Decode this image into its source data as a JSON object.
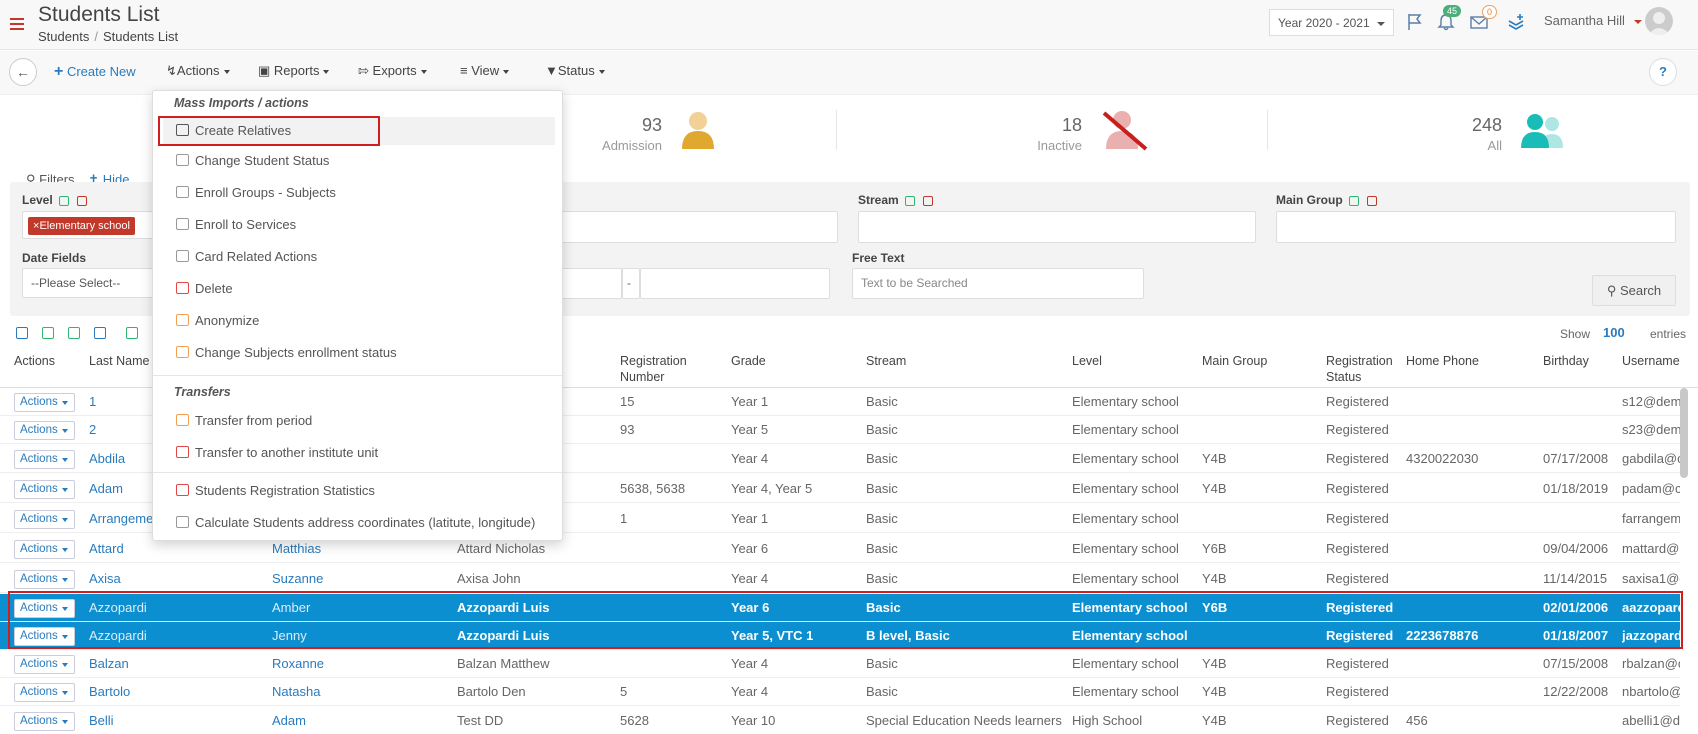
{
  "header": {
    "title": "Students List",
    "breadcrumb": [
      "Students",
      "Students List"
    ],
    "year": "Year 2020 - 2021",
    "notifications_count": "45",
    "messages_count": "0",
    "user_name": "Samantha Hill"
  },
  "toolbar": {
    "create_new": "Create New",
    "actions": "Actions",
    "reports": "Reports",
    "exports": "Exports",
    "view": "View",
    "status": "Status",
    "help": "?"
  },
  "stats": [
    {
      "value": "93",
      "label": "Admission",
      "color": "#e0a82e"
    },
    {
      "value": "18",
      "label": "Inactive",
      "color": "#e8a0a0"
    },
    {
      "value": "248",
      "label": "All",
      "color": "#1abcb8"
    }
  ],
  "filters": {
    "title": "Filters",
    "hide": "Hide",
    "level_label": "Level",
    "level_tag": "Elementary school",
    "stream_label": "Stream",
    "main_group_label": "Main Group",
    "date_fields_label": "Date Fields",
    "date_placeholder": "--Please Select--",
    "date_sep": "-",
    "free_text_label": "Free Text",
    "free_text_placeholder": "Text to be Searched",
    "search": "Search"
  },
  "table": {
    "show_label": "Show",
    "show_value": "100",
    "entries_label": "entries",
    "columns": [
      "Actions",
      "Last Name",
      "Registration Number",
      "Grade",
      "Stream",
      "Level",
      "Main Group",
      "Registration Status",
      "Home Phone",
      "Birthday",
      "Username"
    ],
    "action_label": "Actions",
    "rows": [
      {
        "last": "1",
        "first": "",
        "parent": "",
        "reg": "15",
        "grade": "Year 1",
        "stream": "Basic",
        "level": "Elementary school",
        "group": "",
        "status": "Registered",
        "phone": "",
        "birthday": "",
        "user": "s12@dem"
      },
      {
        "last": "2",
        "first": "",
        "parent": "",
        "reg": "93",
        "grade": "Year 5",
        "stream": "Basic",
        "level": "Elementary school",
        "group": "",
        "status": "Registered",
        "phone": "",
        "birthday": "",
        "user": "s23@dem"
      },
      {
        "last": "Abdila",
        "first": "",
        "parent": "",
        "reg": "",
        "grade": "Year 4",
        "stream": "Basic",
        "level": "Elementary school",
        "group": "Y4B",
        "status": "Registered",
        "phone": "4320022030",
        "birthday": "07/17/2008",
        "user": "gabdila@c"
      },
      {
        "last": "Adam",
        "first": "",
        "parent": "",
        "reg": "5638, 5638",
        "grade": "Year 4, Year 5",
        "stream": "Basic",
        "level": "Elementary school",
        "group": "Y4B",
        "status": "Registered",
        "phone": "",
        "birthday": "01/18/2019",
        "user": "padam@c"
      },
      {
        "last": "Arrangeme",
        "first": "",
        "parent": "",
        "reg": "1",
        "grade": "Year 1",
        "stream": "Basic",
        "level": "Elementary school",
        "group": "",
        "status": "Registered",
        "phone": "",
        "birthday": "",
        "user": "farrangem"
      },
      {
        "last": "Attard",
        "first": "Matthias",
        "parent": "Attard Nicholas",
        "reg": "",
        "grade": "Year 6",
        "stream": "Basic",
        "level": "Elementary school",
        "group": "Y6B",
        "status": "Registered",
        "phone": "",
        "birthday": "09/04/2006",
        "user": "mattard@"
      },
      {
        "last": "Axisa",
        "first": "Suzanne",
        "parent": "Axisa John",
        "reg": "",
        "grade": "Year 4",
        "stream": "Basic",
        "level": "Elementary school",
        "group": "Y4B",
        "status": "Registered",
        "phone": "",
        "birthday": "11/14/2015",
        "user": "saxisa1@c"
      },
      {
        "last": "Azzopardi",
        "first": "Amber",
        "parent": "Azzopardi Luis",
        "reg": "",
        "grade": "Year 6",
        "stream": "Basic",
        "level": "Elementary school",
        "group": "Y6B",
        "status": "Registered",
        "phone": "",
        "birthday": "02/01/2006",
        "user": "aazzopard",
        "selected": true
      },
      {
        "last": "Azzopardi",
        "first": "Jenny",
        "parent": "Azzopardi Luis",
        "reg": "",
        "grade": "Year 5, VTC 1",
        "stream": "B level, Basic",
        "level": "Elementary school",
        "group": "",
        "status": "Registered",
        "phone": "2223678876",
        "birthday": "01/18/2007",
        "user": "jazzopard",
        "selected": true
      },
      {
        "last": "Balzan",
        "first": "Roxanne",
        "parent": "Balzan Matthew",
        "reg": "",
        "grade": "Year 4",
        "stream": "Basic",
        "level": "Elementary school",
        "group": "Y4B",
        "status": "Registered",
        "phone": "",
        "birthday": "07/15/2008",
        "user": "rbalzan@c"
      },
      {
        "last": "Bartolo",
        "first": "Natasha",
        "parent": "Bartolo Den",
        "reg": "5",
        "grade": "Year 4",
        "stream": "Basic",
        "level": "Elementary school",
        "group": "Y4B",
        "status": "Registered",
        "phone": "",
        "birthday": "12/22/2008",
        "user": "nbartolo@"
      },
      {
        "last": "Belli",
        "first": "Adam",
        "parent": "Test DD",
        "reg": "5628",
        "grade": "Year 10",
        "stream": "Special Education Needs learners",
        "level": "High School",
        "group": "Y4B",
        "status": "Registered",
        "phone": "456",
        "birthday": "",
        "user": "abelli1@d"
      }
    ]
  },
  "actions_menu": {
    "section_mass": "Mass Imports / actions",
    "items_mass": [
      {
        "label": "Create Relatives",
        "icon": "relatives-icon",
        "color": "#555555"
      },
      {
        "label": "Change Student Status",
        "icon": "user-status-icon",
        "color": "#999999"
      },
      {
        "label": "Enroll Groups - Subjects",
        "icon": "enroll-icon",
        "color": "#999999"
      },
      {
        "label": "Enroll to Services",
        "icon": "services-icon",
        "color": "#999999"
      },
      {
        "label": "Card Related Actions",
        "icon": "card-icon",
        "color": "#999999"
      },
      {
        "label": "Delete",
        "icon": "trash-icon",
        "color": "#e04848"
      },
      {
        "label": "Anonymize",
        "icon": "anonymize-icon",
        "color": "#f0a050"
      },
      {
        "label": "Change Subjects enrollment status",
        "icon": "subjects-status-icon",
        "color": "#f0a050"
      }
    ],
    "section_transfers": "Transfers",
    "items_transfers": [
      {
        "label": "Transfer from period",
        "icon": "transfer-icon",
        "color": "#f0a050"
      },
      {
        "label": "Transfer to another institute unit",
        "icon": "transfer-unit-icon",
        "color": "#e04848"
      }
    ],
    "items_other": [
      {
        "label": "Students Registration Statistics",
        "icon": "statistics-icon",
        "color": "#e04848"
      },
      {
        "label": "Calculate Students address coordinates (latitute, longitude)",
        "icon": "coordinates-icon",
        "color": "#999999"
      }
    ]
  }
}
